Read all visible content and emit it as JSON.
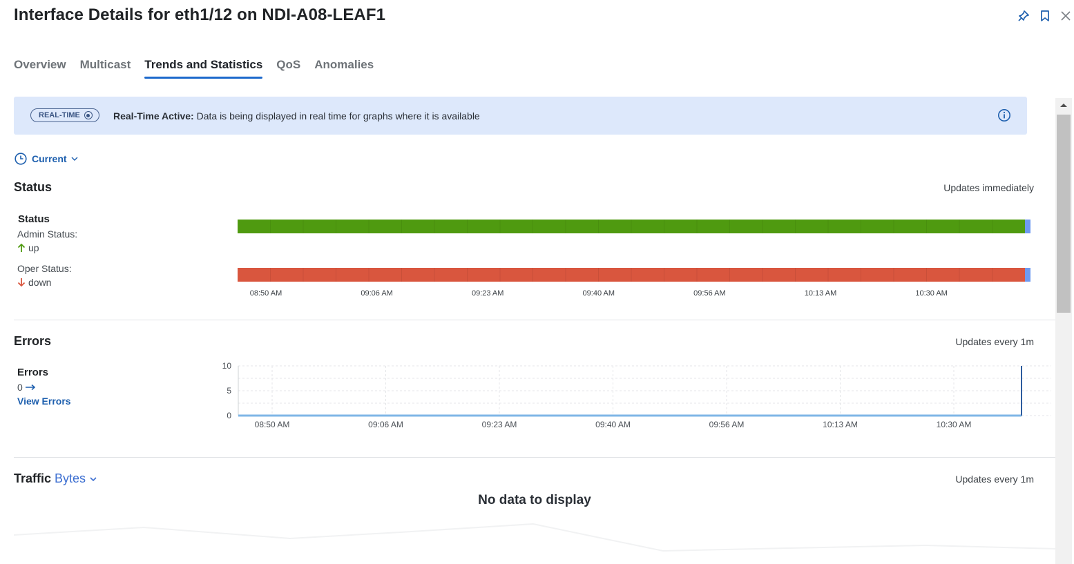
{
  "header": {
    "title": "Interface Details for eth1/12 on NDI-A08-LEAF1",
    "icons": [
      "pin-icon",
      "bookmark-icon",
      "close-icon"
    ]
  },
  "tabs": [
    {
      "label": "Overview"
    },
    {
      "label": "Multicast"
    },
    {
      "label": "Trends and Statistics",
      "active": true
    },
    {
      "label": "QoS"
    },
    {
      "label": "Anomalies"
    }
  ],
  "banner": {
    "pill": "REAL-TIME",
    "bold": "Real-Time Active:",
    "text": " Data is being displayed in real time for graphs where it is available"
  },
  "time_selector": {
    "label": "Current"
  },
  "status_section": {
    "title": "Status",
    "updates": "Updates immediately",
    "heading": "Status",
    "admin_label": "Admin Status:",
    "admin_value": "up",
    "oper_label": "Oper Status:",
    "oper_value": "down",
    "ticks": [
      "08:50 AM",
      "09:06 AM",
      "09:23 AM",
      "09:40 AM",
      "09:56 AM",
      "10:13 AM",
      "10:30 AM"
    ],
    "colors": {
      "up": "#4f9a10",
      "down": "#d9563e",
      "now_marker": "#6f9af0"
    }
  },
  "errors_section": {
    "title": "Errors",
    "updates": "Updates every 1m",
    "heading": "Errors",
    "value": "0",
    "link": "View Errors"
  },
  "traffic_section": {
    "title": "Traffic",
    "metric": "Bytes",
    "updates": "Updates every 1m",
    "empty": "No data to display"
  },
  "chart_data": {
    "type": "line",
    "x": [
      "08:50 AM",
      "09:06 AM",
      "09:23 AM",
      "09:40 AM",
      "09:56 AM",
      "10:13 AM",
      "10:30 AM"
    ],
    "series": [
      {
        "values": [
          0,
          0,
          0,
          0,
          0,
          0,
          0
        ]
      }
    ],
    "yticks": [
      0,
      5,
      10
    ],
    "ylim": [
      0,
      10
    ],
    "grid": true,
    "color": "#7fb6e6"
  }
}
